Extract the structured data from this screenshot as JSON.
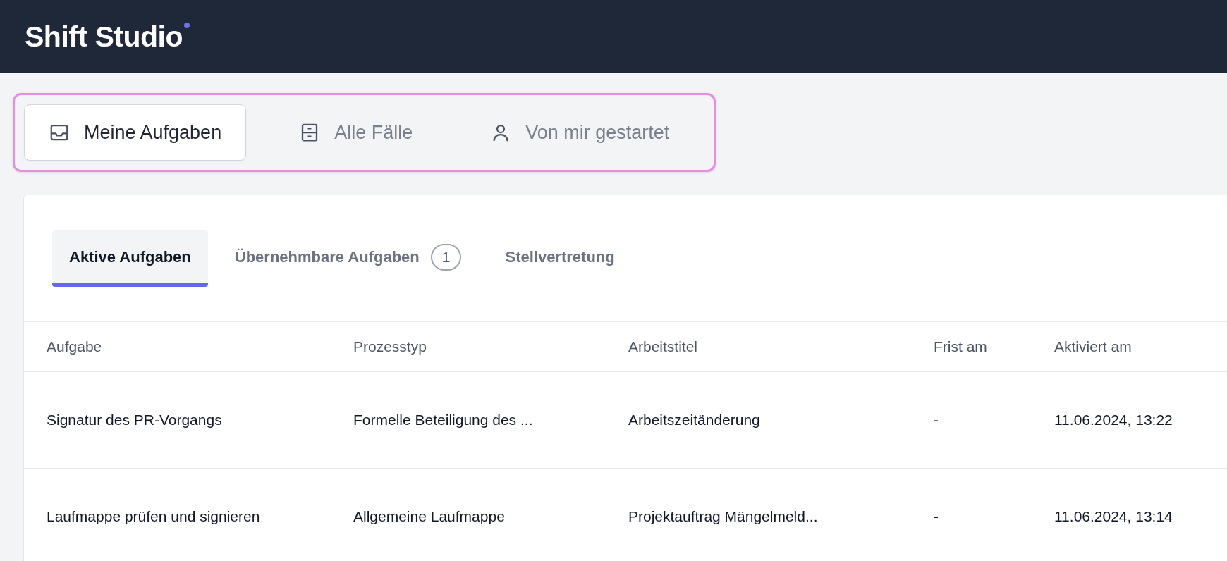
{
  "app": {
    "title": "Shift Studio"
  },
  "views": [
    {
      "label": "Meine Aufgaben",
      "selected": true
    },
    {
      "label": "Alle Fälle",
      "selected": false
    },
    {
      "label": "Von mir gestartet",
      "selected": false
    }
  ],
  "tabs": [
    {
      "label": "Aktive Aufgaben",
      "selected": true
    },
    {
      "label": "Übernehmbare Aufgaben",
      "count": "1",
      "selected": false
    },
    {
      "label": "Stellvertretung",
      "selected": false
    }
  ],
  "table": {
    "columns": [
      "Aufgabe",
      "Prozesstyp",
      "Arbeitstitel",
      "Frist am",
      "Aktiviert am"
    ],
    "rows": [
      [
        "Signatur des PR-Vorgangs",
        "Formelle Beteiligung des ...",
        "Arbeitszeitänderung",
        "-",
        "11.06.2024, 13:22"
      ],
      [
        "Laufmappe prüfen und signieren",
        "Allgemeine Laufmappe",
        "Projektauftrag Mängelmeld...",
        "-",
        "11.06.2024, 13:14"
      ]
    ]
  }
}
